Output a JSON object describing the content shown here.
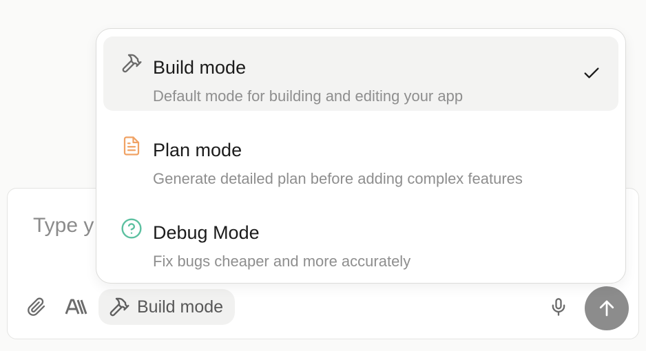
{
  "composer": {
    "placeholder": "Type y",
    "mode_pill_label": "Build mode",
    "icons": {
      "attach": "paperclip-icon",
      "font": "text-style-icon",
      "mode": "hammer-icon",
      "mic": "microphone-icon",
      "send": "arrow-up-icon"
    }
  },
  "mode_menu": {
    "selected": "build",
    "options": [
      {
        "id": "build",
        "title": "Build mode",
        "description": "Default mode for building and editing your app",
        "icon": "hammer-icon",
        "icon_color": "#6b6b6b",
        "checked": true
      },
      {
        "id": "plan",
        "title": "Plan mode",
        "description": "Generate detailed plan before adding complex features",
        "icon": "document-icon",
        "icon_color": "#f0a264",
        "checked": false
      },
      {
        "id": "debug",
        "title": "Debug Mode",
        "description": "Fix bugs cheaper and more accurately",
        "icon": "question-circle-icon",
        "icon_color": "#5cc0a0",
        "checked": false
      }
    ]
  },
  "colors": {
    "send_button": "#8c8c8c",
    "selected_row": "#f3f3f2",
    "pill_bg": "#f1f1f0"
  }
}
